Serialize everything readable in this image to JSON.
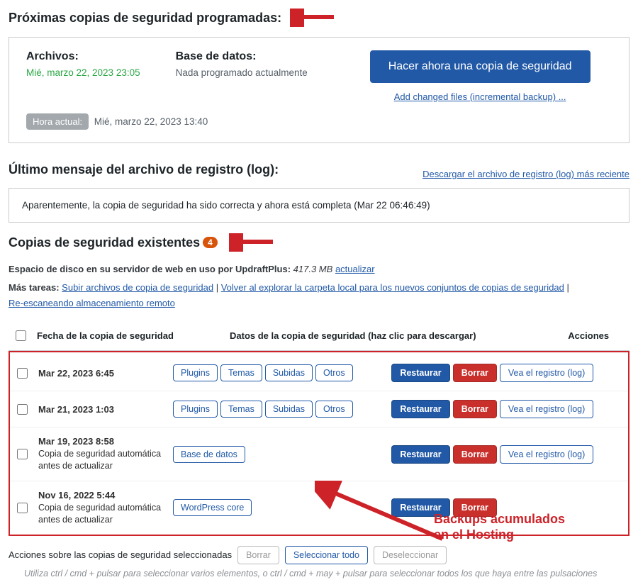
{
  "scheduled": {
    "heading": "Próximas copias de seguridad programadas:",
    "files_h": "Archivos:",
    "files_v": "Mié, marzo 22, 2023 23:05",
    "db_h": "Base de datos:",
    "db_v": "Nada programado actualmente",
    "now_label": "Hora actual:",
    "now_v": "Mié, marzo 22, 2023 13:40",
    "btn": "Hacer ahora una copia de seguridad",
    "incr": "Add changed files (incremental backup) ..."
  },
  "lastlog": {
    "heading": "Último mensaje del archivo de registro (log):",
    "dl": "Descargar el archivo de registro (log) más reciente",
    "msg": "Aparentemente, la copia de seguridad ha sido correcta y ahora está completa (Mar 22 06:46:49)"
  },
  "existing": {
    "heading": "Copias de seguridad existentes",
    "count": "4",
    "disk1a": "Espacio de disco en su servidor de web en uso por UpdraftPlus:",
    "disk1b": "417.3 MB",
    "update": "actualizar",
    "more_label": "Más tareas:",
    "link1": "Subir archivos de copia de seguridad",
    "link2": "Volver al explorar la carpeta local para los nuevos conjuntos de copias de seguridad",
    "link3": "Re-escaneando almacenamiento remoto"
  },
  "table": {
    "h_date": "Fecha de la copia de seguridad",
    "h_data": "Datos de la copia de seguridad (haz clic para descargar)",
    "h_act": "Acciones",
    "rows": [
      {
        "date": "Mar 22, 2023 6:45",
        "sub": "",
        "chips": [
          "Plugins",
          "Temas",
          "Subidas",
          "Otros"
        ],
        "log": true
      },
      {
        "date": "Mar 21, 2023 1:03",
        "sub": "",
        "chips": [
          "Plugins",
          "Temas",
          "Subidas",
          "Otros"
        ],
        "log": true
      },
      {
        "date": "Mar 19, 2023 8:58",
        "sub": "Copia de seguridad automática antes de actualizar",
        "chips": [
          "Base de datos"
        ],
        "log": true
      },
      {
        "date": "Nov 16, 2022 5:44",
        "sub": "Copia de seguridad automática antes de actualizar",
        "chips": [
          "WordPress core"
        ],
        "log": false
      }
    ],
    "restore": "Restaurar",
    "delete": "Borrar",
    "viewlog": "Vea el registro (log)"
  },
  "bottom": {
    "label": "Acciones sobre las copias de seguridad seleccionadas",
    "borrar": "Borrar",
    "selall": "Seleccionar todo",
    "desel": "Deseleccionar",
    "hint": "Utiliza ctrl / cmd + pulsar para seleccionar varios elementos, o ctrl / cmd + may + pulsar para seleccionar todos los que haya entre las pulsaciones"
  },
  "annot": {
    "text": "Backups acumulados\nen el Hosting"
  }
}
